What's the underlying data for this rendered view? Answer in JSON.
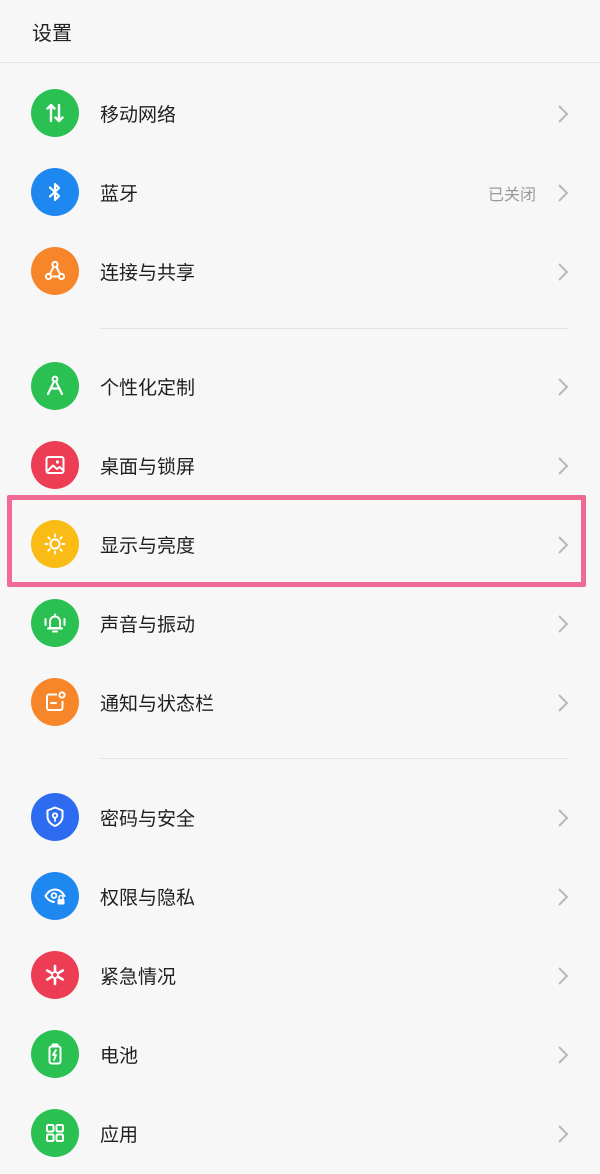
{
  "header": {
    "title": "设置"
  },
  "items": [
    {
      "id": "mobile-network",
      "label": "移动网络",
      "status": "",
      "color": "#2bc152",
      "icon": "mobile-data-icon"
    },
    {
      "id": "bluetooth",
      "label": "蓝牙",
      "status": "已关闭",
      "color": "#1e88f0",
      "icon": "bluetooth-icon"
    },
    {
      "id": "connection-sharing",
      "label": "连接与共享",
      "status": "",
      "color": "#f7862a",
      "icon": "share-network-icon"
    },
    {
      "id": "personalization",
      "label": "个性化定制",
      "status": "",
      "color": "#2bc152",
      "icon": "compass-icon"
    },
    {
      "id": "desktop-lockscreen",
      "label": "桌面与锁屏",
      "status": "",
      "color": "#ec3d55",
      "icon": "image-icon"
    },
    {
      "id": "display-brightness",
      "label": "显示与亮度",
      "status": "",
      "color": "#f9bb14",
      "icon": "sun-icon"
    },
    {
      "id": "sound-vibration",
      "label": "声音与振动",
      "status": "",
      "color": "#2bc152",
      "icon": "bell-icon"
    },
    {
      "id": "notification-statusbar",
      "label": "通知与状态栏",
      "status": "",
      "color": "#f7862a",
      "icon": "notification-icon"
    },
    {
      "id": "password-security",
      "label": "密码与安全",
      "status": "",
      "color": "#2d6cf0",
      "icon": "shield-lock-icon"
    },
    {
      "id": "permission-privacy",
      "label": "权限与隐私",
      "status": "",
      "color": "#1e88f0",
      "icon": "eye-lock-icon"
    },
    {
      "id": "emergency",
      "label": "紧急情况",
      "status": "",
      "color": "#ec3d55",
      "icon": "asterisk-icon"
    },
    {
      "id": "battery",
      "label": "电池",
      "status": "",
      "color": "#2bc152",
      "icon": "battery-icon"
    },
    {
      "id": "apps",
      "label": "应用",
      "status": "",
      "color": "#2bc152",
      "icon": "grid-icon"
    }
  ],
  "highlight_color": "#f06b94"
}
